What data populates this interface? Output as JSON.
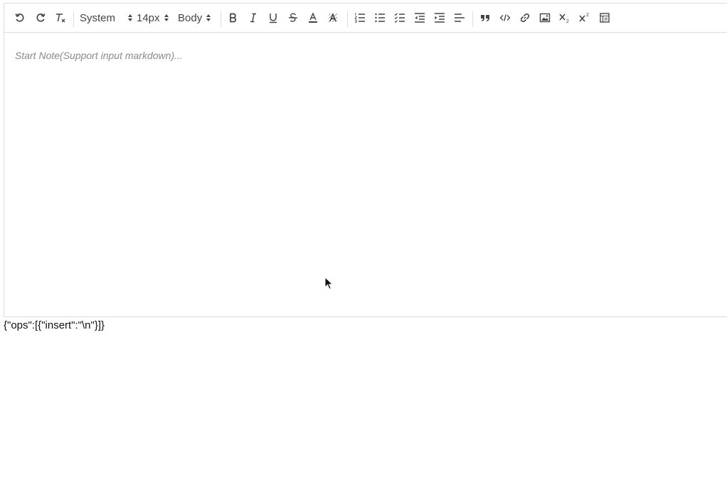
{
  "toolbar": {
    "font_family": "System",
    "font_size": "14px",
    "heading": "Body",
    "buttons": {
      "undo": "undo-icon",
      "redo": "redo-icon",
      "clear_format": "clear-format-icon",
      "bold": "bold-icon",
      "italic": "italic-icon",
      "underline": "underline-icon",
      "strike": "strikethrough-icon",
      "font_color": "font-color-icon",
      "background_color": "background-color-icon",
      "ordered_list": "ordered-list-icon",
      "bullet_list": "bullet-list-icon",
      "check_list": "checklist-icon",
      "outdent": "outdent-icon",
      "indent": "indent-icon",
      "align": "align-left-icon",
      "blockquote": "blockquote-icon",
      "code": "code-icon",
      "link": "link-icon",
      "image": "image-icon",
      "subscript": "subscript-icon",
      "superscript": "superscript-icon",
      "table": "table-icon"
    }
  },
  "editor": {
    "placeholder": "Start Note(Support input markdown)..."
  },
  "output": {
    "delta_json": "{\"ops\":[{\"insert\":\"\\n\"}]}"
  },
  "colors": {
    "border": "#dcdcdc",
    "icon": "#444444",
    "placeholder": "#8a8a8a"
  }
}
